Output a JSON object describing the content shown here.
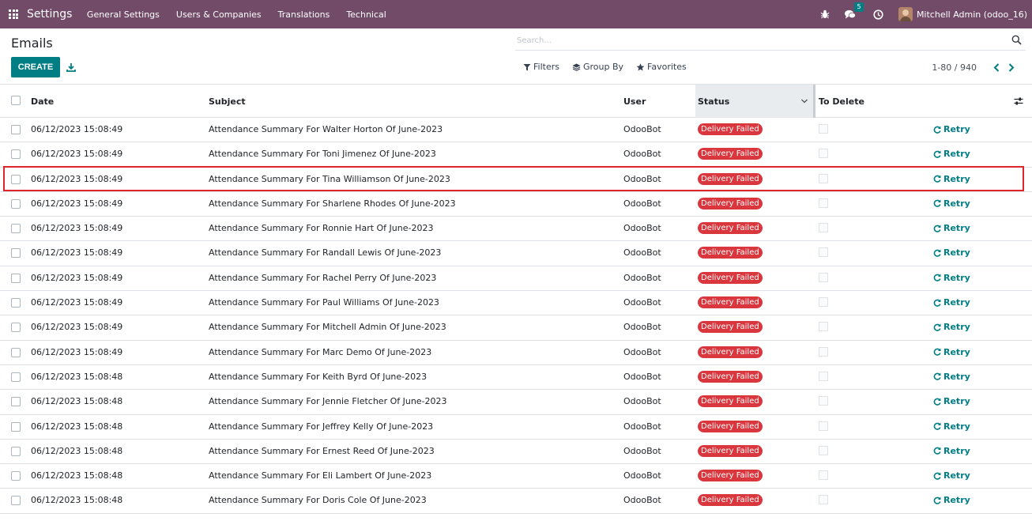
{
  "navbar": {
    "app_name": "Settings",
    "menu": [
      "General Settings",
      "Users & Companies",
      "Translations",
      "Technical"
    ],
    "chat_count": "5",
    "user_name": "Mitchell Admin (odoo_16)"
  },
  "control": {
    "title": "Emails",
    "create_label": "CREATE",
    "search_placeholder": "Search...",
    "filters_label": "Filters",
    "groupby_label": "Group By",
    "favorites_label": "Favorites",
    "pager": "1-80 / 940"
  },
  "table": {
    "headers": {
      "date": "Date",
      "subject": "Subject",
      "user": "User",
      "status": "Status",
      "to_delete": "To Delete"
    },
    "rows": [
      {
        "date": "06/12/2023 15:08:49",
        "subject": "Attendance Summary For Walter Horton Of June-2023",
        "user": "OdooBot",
        "status": "Delivery Failed",
        "action": "Retry"
      },
      {
        "date": "06/12/2023 15:08:49",
        "subject": "Attendance Summary For Toni Jimenez Of June-2023",
        "user": "OdooBot",
        "status": "Delivery Failed",
        "action": "Retry"
      },
      {
        "date": "06/12/2023 15:08:49",
        "subject": "Attendance Summary For Tina Williamson Of June-2023",
        "user": "OdooBot",
        "status": "Delivery Failed",
        "action": "Retry"
      },
      {
        "date": "06/12/2023 15:08:49",
        "subject": "Attendance Summary For Sharlene Rhodes Of June-2023",
        "user": "OdooBot",
        "status": "Delivery Failed",
        "action": "Retry"
      },
      {
        "date": "06/12/2023 15:08:49",
        "subject": "Attendance Summary For Ronnie Hart Of June-2023",
        "user": "OdooBot",
        "status": "Delivery Failed",
        "action": "Retry"
      },
      {
        "date": "06/12/2023 15:08:49",
        "subject": "Attendance Summary For Randall Lewis Of June-2023",
        "user": "OdooBot",
        "status": "Delivery Failed",
        "action": "Retry"
      },
      {
        "date": "06/12/2023 15:08:49",
        "subject": "Attendance Summary For Rachel Perry Of June-2023",
        "user": "OdooBot",
        "status": "Delivery Failed",
        "action": "Retry"
      },
      {
        "date": "06/12/2023 15:08:49",
        "subject": "Attendance Summary For Paul Williams Of June-2023",
        "user": "OdooBot",
        "status": "Delivery Failed",
        "action": "Retry"
      },
      {
        "date": "06/12/2023 15:08:49",
        "subject": "Attendance Summary For Mitchell Admin Of June-2023",
        "user": "OdooBot",
        "status": "Delivery Failed",
        "action": "Retry"
      },
      {
        "date": "06/12/2023 15:08:49",
        "subject": "Attendance Summary For Marc Demo Of June-2023",
        "user": "OdooBot",
        "status": "Delivery Failed",
        "action": "Retry"
      },
      {
        "date": "06/12/2023 15:08:48",
        "subject": "Attendance Summary For Keith Byrd Of June-2023",
        "user": "OdooBot",
        "status": "Delivery Failed",
        "action": "Retry"
      },
      {
        "date": "06/12/2023 15:08:48",
        "subject": "Attendance Summary For Jennie Fletcher Of June-2023",
        "user": "OdooBot",
        "status": "Delivery Failed",
        "action": "Retry"
      },
      {
        "date": "06/12/2023 15:08:48",
        "subject": "Attendance Summary For Jeffrey Kelly Of June-2023",
        "user": "OdooBot",
        "status": "Delivery Failed",
        "action": "Retry"
      },
      {
        "date": "06/12/2023 15:08:48",
        "subject": "Attendance Summary For Ernest Reed Of June-2023",
        "user": "OdooBot",
        "status": "Delivery Failed",
        "action": "Retry"
      },
      {
        "date": "06/12/2023 15:08:48",
        "subject": "Attendance Summary For Eli Lambert Of June-2023",
        "user": "OdooBot",
        "status": "Delivery Failed",
        "action": "Retry"
      },
      {
        "date": "06/12/2023 15:08:48",
        "subject": "Attendance Summary For Doris Cole Of June-2023",
        "user": "OdooBot",
        "status": "Delivery Failed",
        "action": "Retry"
      }
    ],
    "highlighted_row": 2
  },
  "colors": {
    "navbar": "#714b67",
    "primary": "#017e84",
    "danger": "#d9363e",
    "highlight": "#e0242c"
  }
}
